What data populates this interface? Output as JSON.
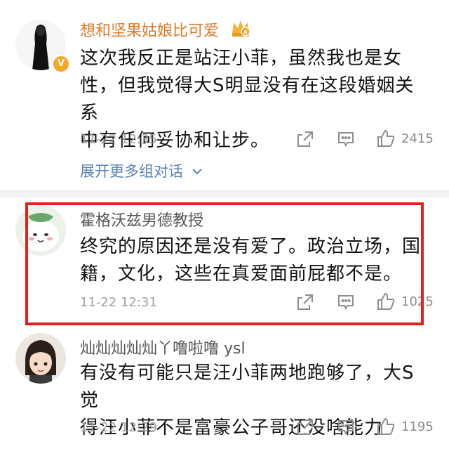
{
  "comments": [
    {
      "username": "想和坚果姑娘比可爱",
      "verified_badge": "V",
      "text_lines": [
        "这次我反正是站汪小菲，虽然我也是女",
        "性，但我觉得大S明显没有在这段婚姻关系",
        "中有任何妥协和让步。"
      ],
      "time": "11-22 12:35",
      "likes": "2415",
      "expand_label": "展开更多组对话",
      "username_color": "#e07a2b"
    },
    {
      "username": "霍格沃兹男德教授",
      "text_lines": [
        "终究的原因还是没有爱了。政治立场，国",
        "籍，文化，这些在真爱面前屁都不是。"
      ],
      "time": "11-22 12:31",
      "likes": "1025",
      "username_color": "#555555",
      "highlighted": true
    },
    {
      "username": "灿灿灿灿灿丫噜啦噜 ysl",
      "text_lines": [
        "有没有可能只是汪小菲两地跑够了，大S觉",
        "得汪小菲不是富豪公子哥还没啥能力"
      ],
      "time": "11-22 12:29",
      "likes": "1195",
      "username_color": "#555555"
    }
  ],
  "icons": [
    "share-icon",
    "comment-icon",
    "like-icon",
    "chevron-down-icon",
    "crown-badge-icon"
  ]
}
